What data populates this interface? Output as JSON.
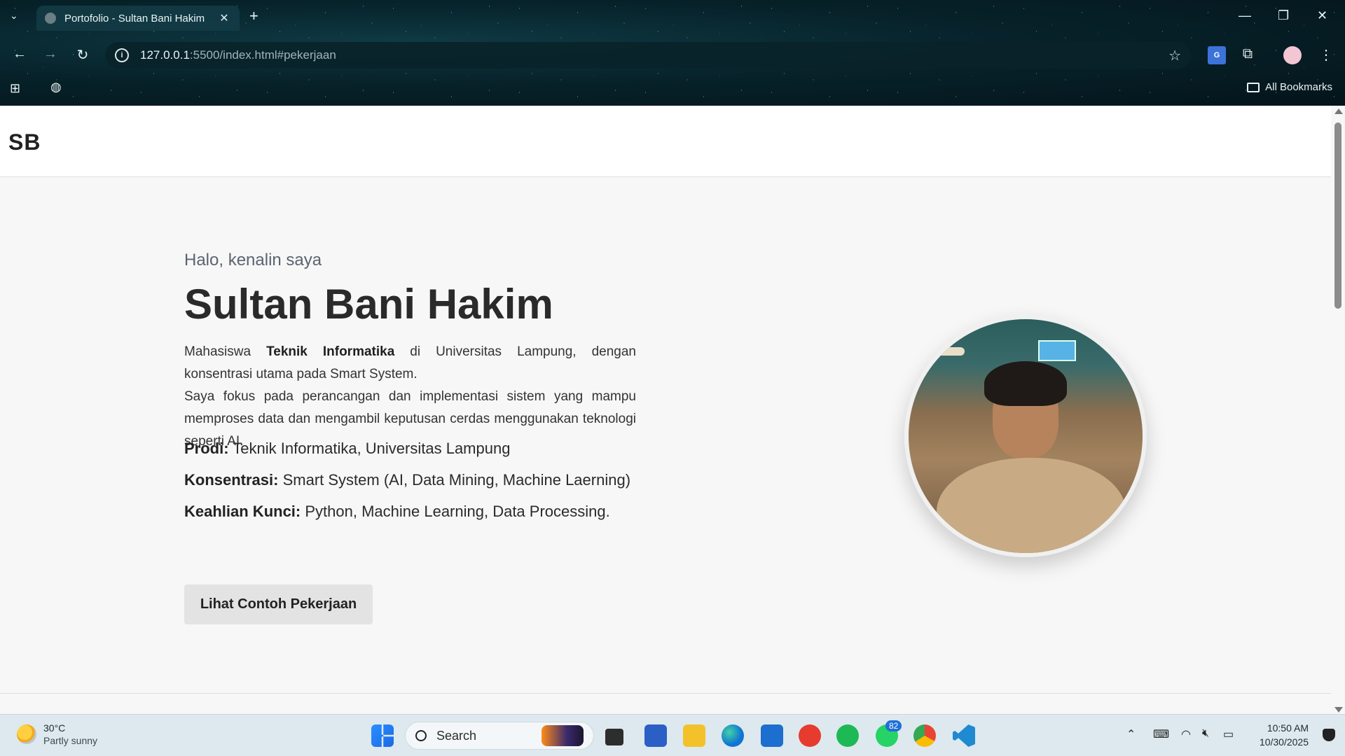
{
  "browser": {
    "tab_title": "Portofolio - Sultan Bani Hakim",
    "url_host": "127.0.0.1",
    "url_rest": ":5500/index.html#pekerjaan",
    "all_bookmarks": "All Bookmarks"
  },
  "site": {
    "logo": "SB",
    "greeting": "Halo, kenalin saya",
    "name": "Sultan Bani Hakim",
    "desc_1a": "Mahasiswa ",
    "desc_1b": "Teknik Informatika",
    "desc_1c": " di Universitas Lampung, dengan konsentrasi utama pada Smart System.",
    "desc_2": "Saya fokus pada perancangan dan implementasi sistem yang mampu memproses data dan mengambil keputusan cerdas menggunakan teknologi seperti AI.",
    "info": [
      {
        "label": "Prodi:",
        "value": " Teknik Informatika, Universitas Lampung"
      },
      {
        "label": "Konsentrasi:",
        "value": " Smart System (AI, Data Mining, Machine Laerning)"
      },
      {
        "label": "Keahlian Kunci:",
        "value": " Python, Machine Learning, Data Processing."
      }
    ],
    "cta_label": "Lihat Contoh Pekerjaan"
  },
  "taskbar": {
    "temperature": "30°C",
    "weather": "Partly sunny",
    "search_label": "Search",
    "whatsapp_badge": "82",
    "time": "10:50 AM",
    "date": "10/30/2025"
  }
}
